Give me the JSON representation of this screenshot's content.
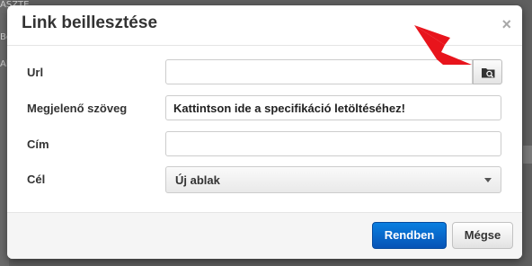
{
  "background": {
    "fragments": [
      "ÁSZTE",
      "Bo",
      "Al"
    ]
  },
  "dialog": {
    "title": "Link beillesztése",
    "close_glyph": "×",
    "fields": {
      "url": {
        "label": "Url",
        "value": ""
      },
      "display_text": {
        "label": "Megjelenő szöveg",
        "value": "Kattintson ide a specifikáció letöltéséhez!"
      },
      "title": {
        "label": "Cím",
        "value": ""
      },
      "target": {
        "label": "Cél",
        "selected": "Új ablak"
      }
    },
    "buttons": {
      "ok": "Rendben",
      "cancel": "Mégse"
    }
  },
  "annotation": {
    "color": "#e8141c"
  },
  "colors": {
    "primary_button": "#0a6ed1"
  }
}
